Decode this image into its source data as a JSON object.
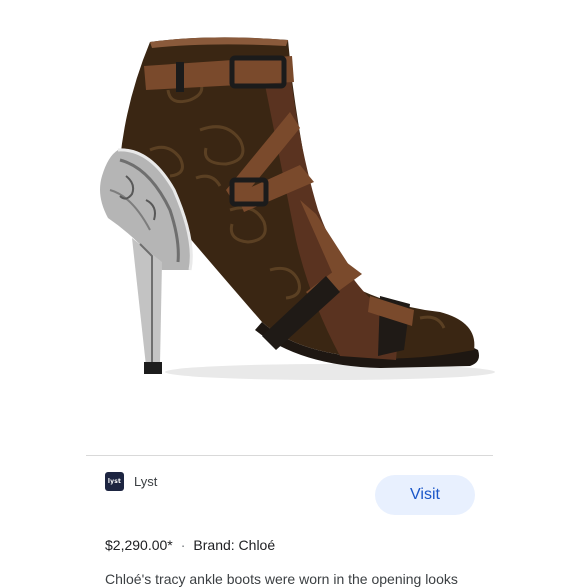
{
  "source": {
    "logo_text": "lyst",
    "name": "Lyst",
    "visit_label": "Visit"
  },
  "product": {
    "price": "$2,290.00*",
    "separator": "·",
    "brand": "Brand: Chloé",
    "description": "Chloé's tracy ankle boots were worn in the opening looks"
  },
  "colors": {
    "accent": "#1a56c8",
    "button_background": "#e8f0fe"
  }
}
